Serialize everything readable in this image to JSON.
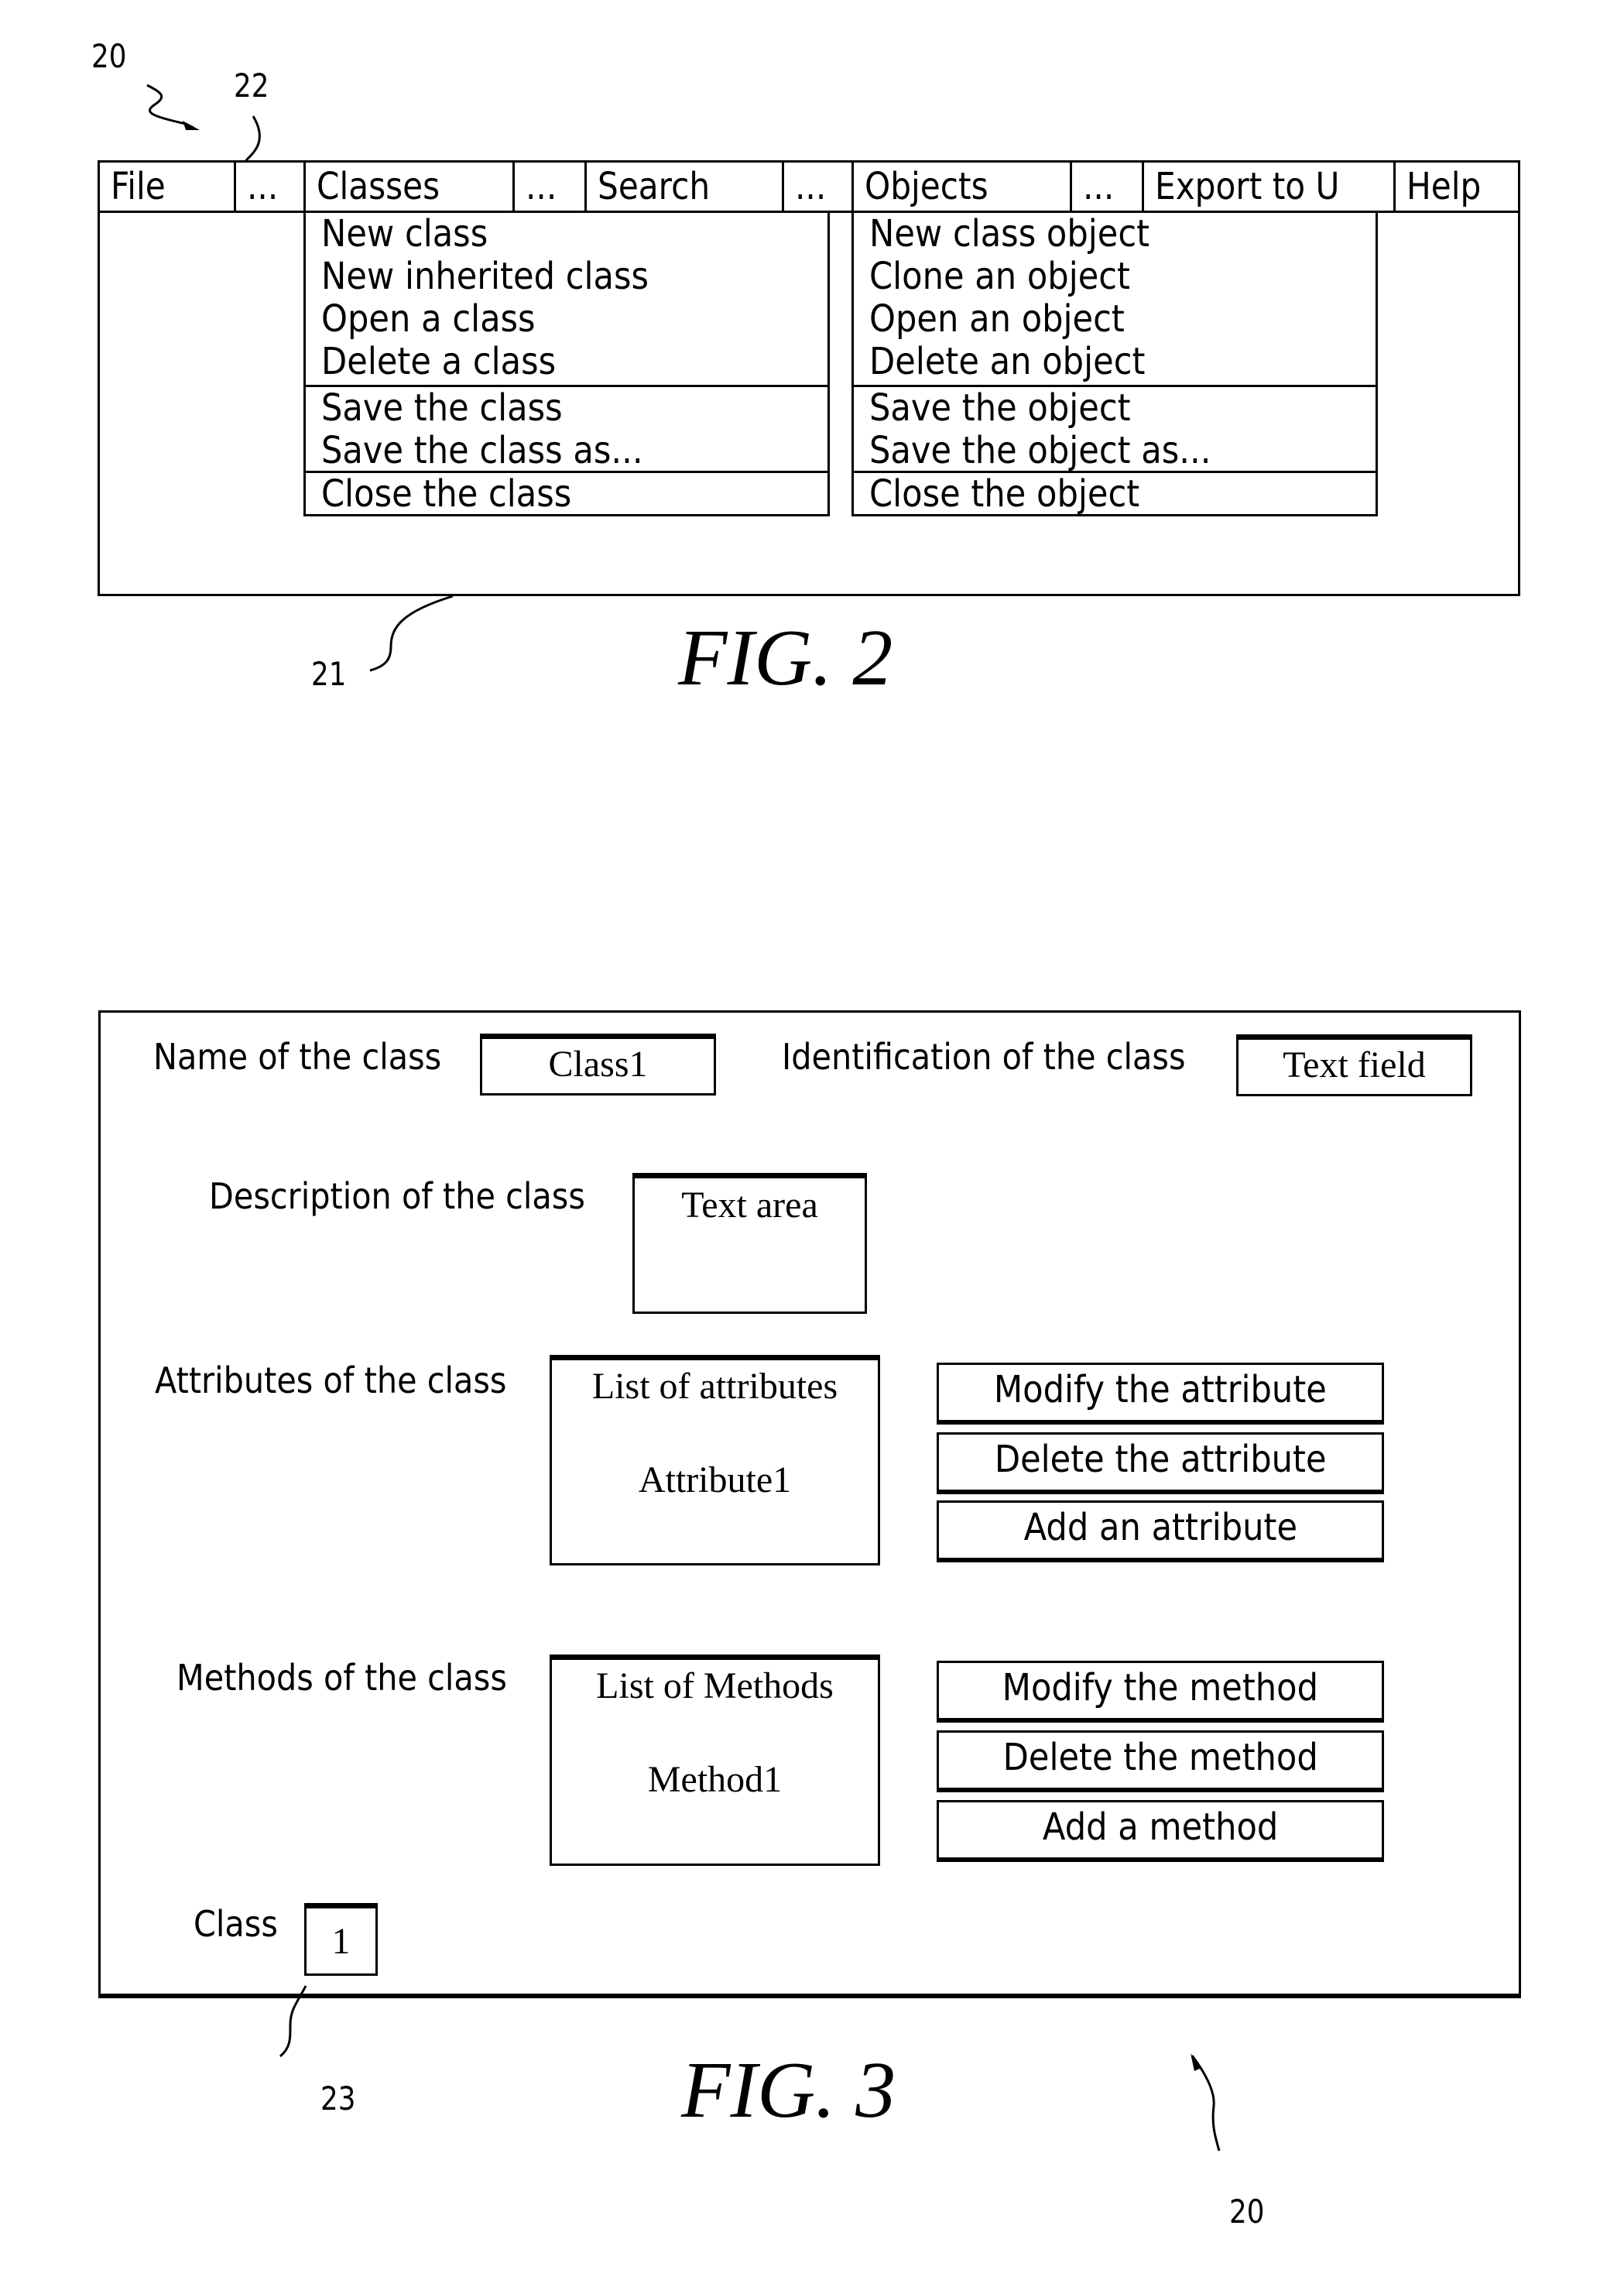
{
  "fig2": {
    "caption": "FIG. 2",
    "refs": {
      "window": "20",
      "menubar": "22",
      "screen": "21"
    },
    "menubar": [
      {
        "label": "File"
      },
      {
        "label": "..."
      },
      {
        "label": "Classes"
      },
      {
        "label": "..."
      },
      {
        "label": "Search"
      },
      {
        "label": "..."
      },
      {
        "label": "Objects"
      },
      {
        "label": "..."
      },
      {
        "label": "Export to U"
      },
      {
        "label": "Help"
      }
    ],
    "classes_menu": {
      "group1": [
        "New class",
        "New inherited class",
        "Open a class",
        "Delete a class"
      ],
      "group2": [
        "Save the class",
        "Save the class as..."
      ],
      "group3": [
        "Close the class"
      ]
    },
    "objects_menu": {
      "group1": [
        "New class object",
        "Clone an object",
        "Open an object",
        "Delete an object"
      ],
      "group2": [
        "Save the object",
        "Save the object as..."
      ],
      "group3": [
        "Close the object"
      ]
    }
  },
  "fig3": {
    "caption": "FIG. 3",
    "refs": {
      "screen": "23",
      "window": "20"
    },
    "name_label": "Name of the class",
    "name_value": "Class1",
    "id_label": "Identification of the class",
    "id_value": "Text field",
    "description_label": "Description of the class",
    "description_value": "Text area",
    "attributes_label": "Attributes of the class",
    "attributes_list_header": "List of attributes",
    "attributes_items": [
      "Attribute1"
    ],
    "attribute_buttons": [
      "Modify the attribute",
      "Delete the attribute",
      "Add an attribute"
    ],
    "methods_label": "Methods of the class",
    "methods_list_header": "List of Methods",
    "methods_items": [
      "Method1"
    ],
    "method_buttons": [
      "Modify the method",
      "Delete the method",
      "Add a method"
    ],
    "class_counter_label": "Class",
    "class_counter_value": "1"
  }
}
